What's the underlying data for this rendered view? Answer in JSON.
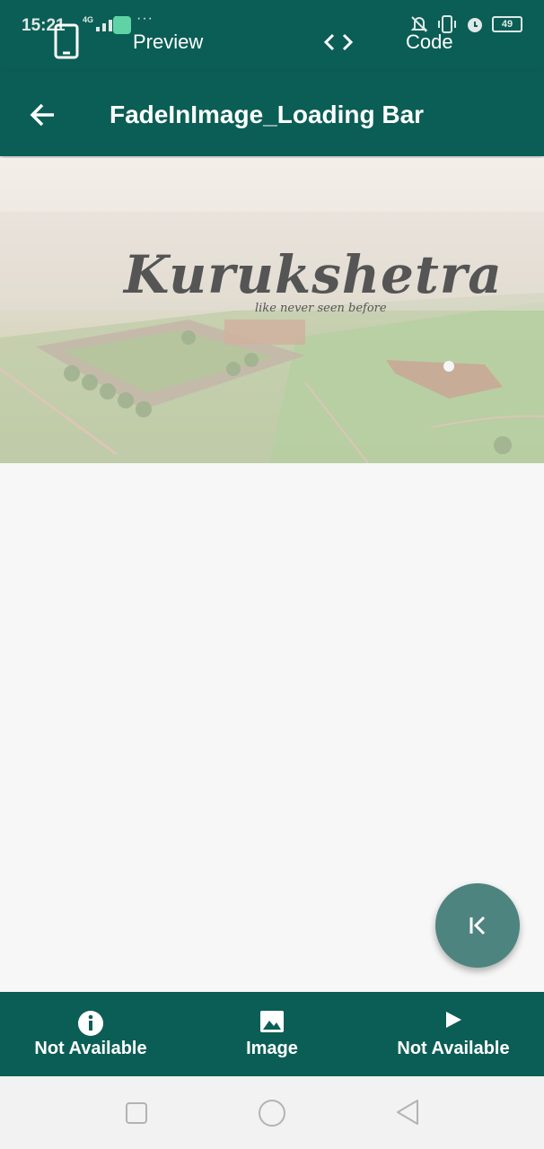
{
  "status_bar": {
    "time": "15:21",
    "network": "4G",
    "battery": "49"
  },
  "tabs": {
    "preview_label": "Preview",
    "code_label": "Code"
  },
  "app_bar": {
    "title": "FadeInImage_Loading Bar"
  },
  "banner": {
    "title": "Kurukshetra",
    "subtitle": "like never seen before"
  },
  "bottom_nav": {
    "items": [
      {
        "label": "Not Available",
        "icon": "info-icon"
      },
      {
        "label": "Image",
        "icon": "image-icon"
      },
      {
        "label": "Not Available",
        "icon": "play-icon"
      }
    ]
  },
  "colors": {
    "primary": "#0b5e55",
    "fab": "#4e847f",
    "background": "#f7f7f7"
  }
}
